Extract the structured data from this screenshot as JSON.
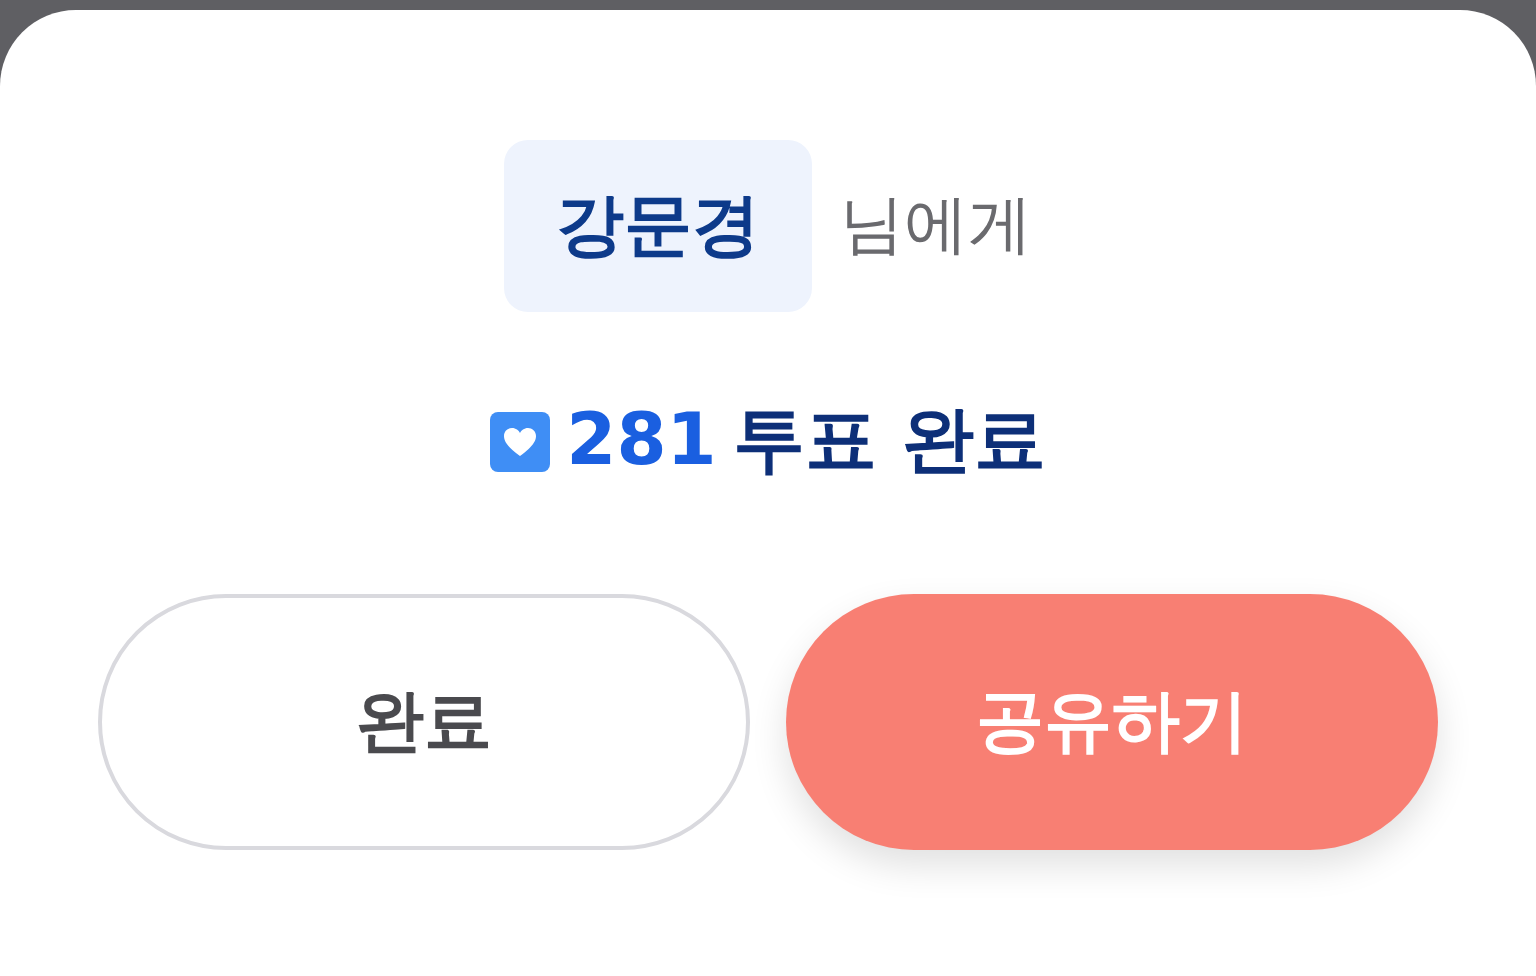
{
  "recipient": {
    "name": "강문경",
    "suffix": "님에게"
  },
  "votes": {
    "count": "281",
    "label": "투표 완료"
  },
  "buttons": [
    {
      "label": "완료",
      "kind": "secondary"
    },
    {
      "label": "공유하기",
      "kind": "primary"
    }
  ]
}
